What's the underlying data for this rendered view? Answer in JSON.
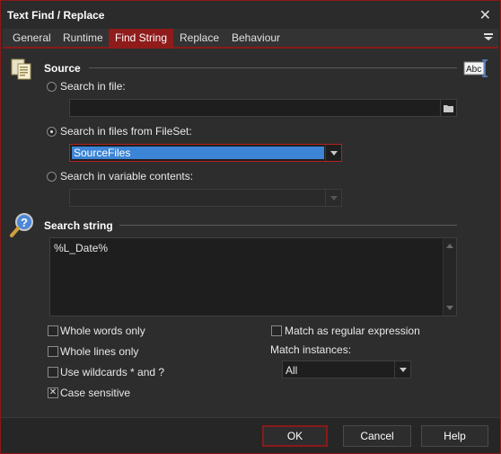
{
  "window": {
    "title": "Text Find / Replace",
    "close_glyph": "✕"
  },
  "tabs": [
    {
      "label": "General"
    },
    {
      "label": "Runtime"
    },
    {
      "label": "Find String"
    },
    {
      "label": "Replace"
    },
    {
      "label": "Behaviour"
    }
  ],
  "active_tab": "Find String",
  "source": {
    "title": "Source",
    "search_in_file": {
      "label": "Search in file:",
      "value": ""
    },
    "search_in_fileset": {
      "label": "Search in files from FileSet:",
      "value": "SourceFiles"
    },
    "search_in_variable": {
      "label": "Search in variable contents:",
      "value": ""
    },
    "selected_option": "search_in_fileset",
    "icons": {
      "section": "documents-icon",
      "right": "text-abc-icon",
      "browse": "folder-icon",
      "dropdown": "chevron-down-icon"
    }
  },
  "search_string": {
    "title": "Search string",
    "value": "%L_Date%",
    "icon": "magnifier-help-icon"
  },
  "options": {
    "whole_words": {
      "label": "Whole words only",
      "checked": false
    },
    "whole_lines": {
      "label": "Whole lines only",
      "checked": false
    },
    "wildcards": {
      "label": "Use wildcards * and ?",
      "checked": false
    },
    "case_sensitive": {
      "label": "Case sensitive",
      "checked": true,
      "mark": "✕"
    },
    "regex": {
      "label": "Match as regular expression",
      "checked": false
    },
    "match_instances_label": "Match instances:",
    "match_instances_value": "All"
  },
  "footer": {
    "ok": "OK",
    "cancel": "Cancel",
    "help": "Help"
  },
  "colors": {
    "accent": "#8f1b1b",
    "selection": "#3b84d6",
    "background": "#2d2d2d"
  }
}
